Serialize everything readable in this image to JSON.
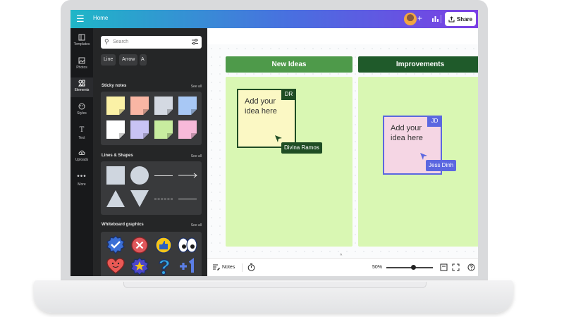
{
  "topbar": {
    "menu_glyph": "☰",
    "home_label": "Home",
    "plus_glyph": "+",
    "share_label": "Share",
    "icons": [
      "menu-icon",
      "avatar",
      "plus-icon",
      "insights-icon",
      "share-icon"
    ]
  },
  "rail": {
    "items": [
      {
        "label": "Templates",
        "icon": "templates-icon"
      },
      {
        "label": "Photos",
        "icon": "photos-icon"
      },
      {
        "label": "Elements",
        "icon": "elements-icon",
        "active": true
      },
      {
        "label": "Styles",
        "icon": "styles-icon"
      },
      {
        "label": "Text",
        "icon": "text-icon"
      },
      {
        "label": "Uploads",
        "icon": "uploads-icon"
      },
      {
        "label": "More",
        "icon": "more-icon"
      }
    ]
  },
  "panel": {
    "search_placeholder": "Search",
    "chips": [
      "Line",
      "Arrow",
      "A"
    ],
    "sticky_notes": {
      "title": "Sticky notes",
      "see_all": "See all"
    },
    "sticky_colors": [
      "#fbf1a6",
      "#f9b6a4",
      "#d4d9e2",
      "#a8c8f5",
      "#ffffff",
      "#c8c3f4",
      "#c8ec9f",
      "#f7b9d9"
    ],
    "lines_shapes": {
      "title": "Lines & Shapes",
      "see_all": "See all"
    },
    "whiteboard": {
      "title": "Whiteboard graphics",
      "see_all": "See all"
    }
  },
  "board": {
    "columns": [
      {
        "title": "New Ideas",
        "header_color": "#4e9a4a"
      },
      {
        "title": "Improvements",
        "header_color": "#1f5a2a"
      }
    ],
    "column_body_color": "#d9f7b3",
    "notes": [
      {
        "text": "Add your idea here",
        "initials": "DR",
        "user": "Divina Ramos",
        "fill": "#fbf8c4",
        "accent": "#1f4d24"
      },
      {
        "text": "Add your idea here",
        "initials": "JD",
        "user": "Jess Dinh",
        "fill": "#f5d6e4",
        "accent": "#5b67e0"
      }
    ]
  },
  "bottombar": {
    "notes_label": "Notes",
    "zoom_label": "50%",
    "caret": "^",
    "zoom_fraction": 0.5
  }
}
